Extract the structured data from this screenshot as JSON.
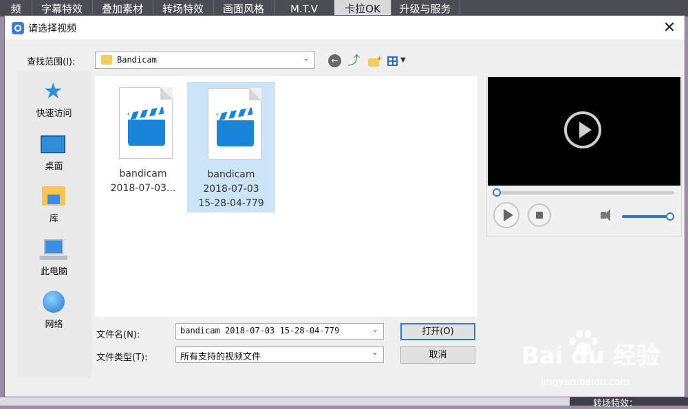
{
  "background_app": {
    "tabs": [
      "频",
      "字幕特效",
      "叠加素材",
      "转场特效",
      "画面风格",
      "M.T.V",
      "卡拉OK",
      "升级与服务"
    ],
    "active_tab": 6,
    "bottom_text": "转场特效："
  },
  "dialog": {
    "title": "请选择视频",
    "close_glyph": "✕",
    "lookin_label": "查找范围(I):",
    "lookin_value": "Bandicam",
    "places": [
      {
        "label": "快速访问",
        "icon": "star-icon"
      },
      {
        "label": "桌面",
        "icon": "desktop-icon"
      },
      {
        "label": "库",
        "icon": "library-icon"
      },
      {
        "label": "此电脑",
        "icon": "computer-icon"
      },
      {
        "label": "网络",
        "icon": "network-icon"
      }
    ],
    "files": [
      {
        "name_lines": [
          "bandicam",
          "2018-07-03..."
        ],
        "selected": false
      },
      {
        "name_lines": [
          "bandicam",
          "2018-07-03",
          "15-28-04-779"
        ],
        "selected": true
      }
    ],
    "filename_label": "文件名(N):",
    "filename_value": "bandicam 2018-07-03 15-28-04-779",
    "filetype_label": "文件类型(T):",
    "filetype_value": "所有支持的视频文件",
    "open_label": "打开(O)",
    "cancel_label": "取消"
  },
  "preview": {
    "seek_progress": 0,
    "volume_level": 1.0
  },
  "watermark": {
    "text": "Bai du 经验",
    "sub": "jingyan.baidu.com"
  },
  "colors": {
    "accent": "#2b78d6",
    "selection": "#cce4f7",
    "video_bg": "#000000"
  }
}
